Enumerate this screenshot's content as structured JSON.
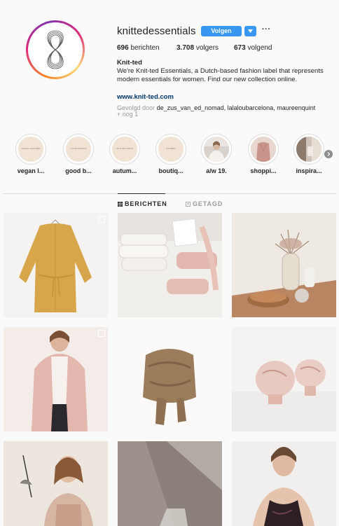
{
  "profile": {
    "username": "knittedessentials",
    "follow_label": "Volgen",
    "more_label": "···",
    "stats": [
      {
        "count": "696",
        "label": "berichten"
      },
      {
        "count": "3.708",
        "label": "volgers"
      },
      {
        "count": "673",
        "label": "volgend"
      }
    ],
    "full_name": "Knit-ted",
    "bio": "We're Knit-ted Essentials, a Dutch-based fashion label that represents modern essentials for women. Find our new collection online.",
    "website": "www.knit-ted.com",
    "followed_by_prefix": "Gevolgd door",
    "followed_by_names": "de_zus_van_ed_nomad, lalaloubarcelona, maureenquint",
    "followed_by_more": "+ nog 1"
  },
  "highlights": [
    {
      "label": "vegan l...",
      "cover_text": "VEGAN LEATHER"
    },
    {
      "label": "good b...",
      "cover_text": "GOOD BASICS"
    },
    {
      "label": "autum...",
      "cover_text": "AUTUMN SHOP"
    },
    {
      "label": "boutiq...",
      "cover_text": "STORES"
    },
    {
      "label": "a/w 19.",
      "cover_text": ""
    },
    {
      "label": "shoppi...",
      "cover_text": ""
    },
    {
      "label": "inspira...",
      "cover_text": ""
    }
  ],
  "tabs": [
    {
      "label": "BERICHTEN"
    },
    {
      "label": "GETAGD"
    }
  ],
  "colors": {
    "accent": "#3897f0",
    "text": "#262626",
    "muted": "#999999",
    "link": "#003569"
  }
}
